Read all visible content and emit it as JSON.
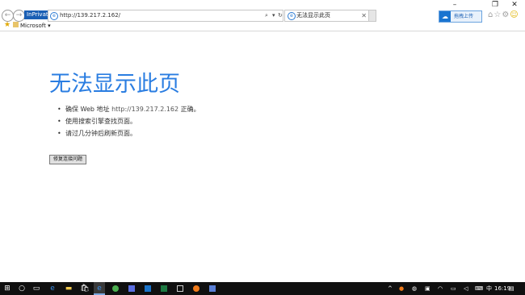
{
  "browser": {
    "inprivate_label": "InPrivate",
    "url": "http://139.217.2.162/",
    "tab_title": "无法显示此页",
    "favorites": {
      "item_label": "Microsoft"
    },
    "extension_button_label": "拖拽上传"
  },
  "page": {
    "heading": "无法显示此页",
    "bullets": [
      {
        "prefix": "确保 Web 地址 ",
        "link": "http://139.217.2.162",
        "suffix": " 正确。"
      },
      {
        "text": "使用搜索引擎查找页面。"
      },
      {
        "text": "请过几分钟后刷新页面。"
      }
    ],
    "fix_button_label": "修复连接问题"
  },
  "taskbar": {
    "ime": "中",
    "time": "16:19"
  },
  "colors": {
    "heading": "#2a7de1",
    "taskbar": "#101010",
    "inprivate_badge": "#1a5fb4"
  },
  "icons": [
    "back-icon",
    "forward-icon",
    "ie-icon",
    "search-icon",
    "dropdown-icon",
    "refresh-icon",
    "close-icon",
    "minimize-icon",
    "maximize-icon",
    "home-icon",
    "favorites-icon",
    "settings-icon",
    "smiley-icon",
    "start-icon",
    "cortana-icon",
    "task-view-icon"
  ]
}
